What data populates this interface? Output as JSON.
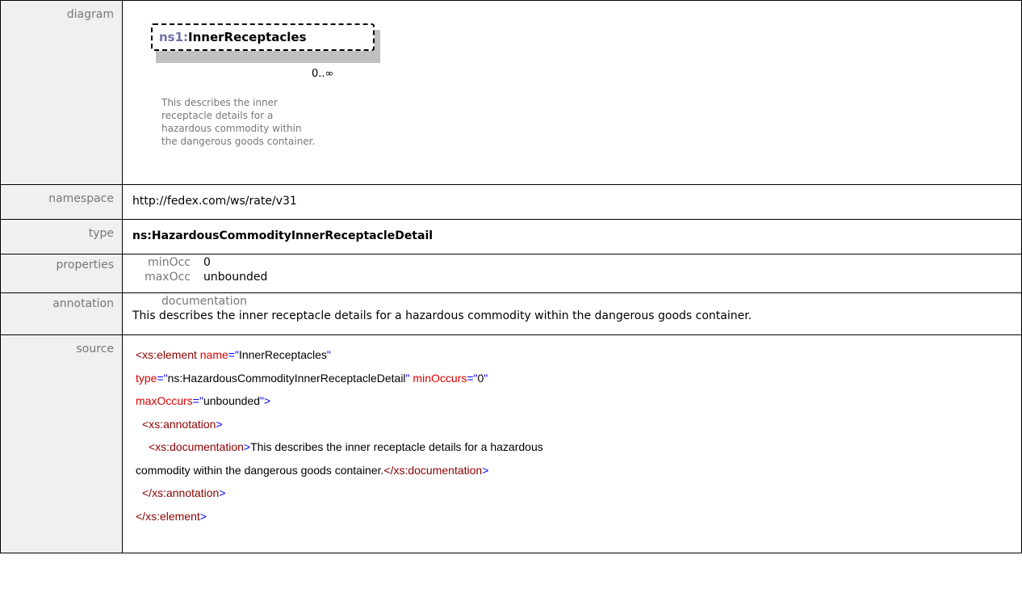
{
  "rows": {
    "diagram": {
      "label": "diagram",
      "box_prefix": "ns1",
      "box_sep": ":",
      "box_name": "InnerReceptacles",
      "cardinality": "0..∞",
      "doc_lines": [
        "This describes the inner",
        "receptacle details for a",
        "hazardous commodity within",
        "the dangerous goods container."
      ]
    },
    "namespace": {
      "label": "namespace",
      "value": "http://fedex.com/ws/rate/v31"
    },
    "type": {
      "label": "type",
      "value": "ns:HazardousCommodityInnerReceptacleDetail"
    },
    "properties": {
      "label": "properties",
      "minOcc_key": "minOcc",
      "minOcc_val": "0",
      "maxOcc_key": "maxOcc",
      "maxOcc_val": "unbounded"
    },
    "annotation": {
      "label": "annotation",
      "doc_key": "documentation",
      "doc_text": "This describes the inner receptacle details for a hazardous commodity within the dangerous goods container."
    },
    "source": {
      "label": "source",
      "lines": {
        "l1_tag": "<xs:element",
        "l1_attr": " name",
        "l1_eq": "=\"",
        "l1_val": "InnerReceptacles",
        "l1_q": "\"",
        "l2_attr": "type",
        "l2_eq": "=\"",
        "l2_val": "ns:HazardousCommodityInnerReceptacleDetail",
        "l2_q": "\"",
        "l2_attr2": " minOccurs",
        "l2_eq2": "=\"",
        "l2_val2": "0",
        "l2_q2": "\"",
        "l3_attr": "maxOccurs",
        "l3_eq": "=\"",
        "l3_val": "unbounded",
        "l3_close": "\">",
        "l4_tag": "<xs:annotation",
        "l4_close": ">",
        "l5_tag": "<xs:documentation",
        "l5_close": ">",
        "l5_text": "This describes the inner receptacle details for a hazardous",
        "l6_text": "commodity within the dangerous goods container.",
        "l6_tag": "</xs:documentation",
        "l6_close": ">",
        "l7_tag": "</xs:annotation",
        "l7_close": ">",
        "l8_tag": "</xs:element",
        "l8_close": ">"
      }
    }
  }
}
